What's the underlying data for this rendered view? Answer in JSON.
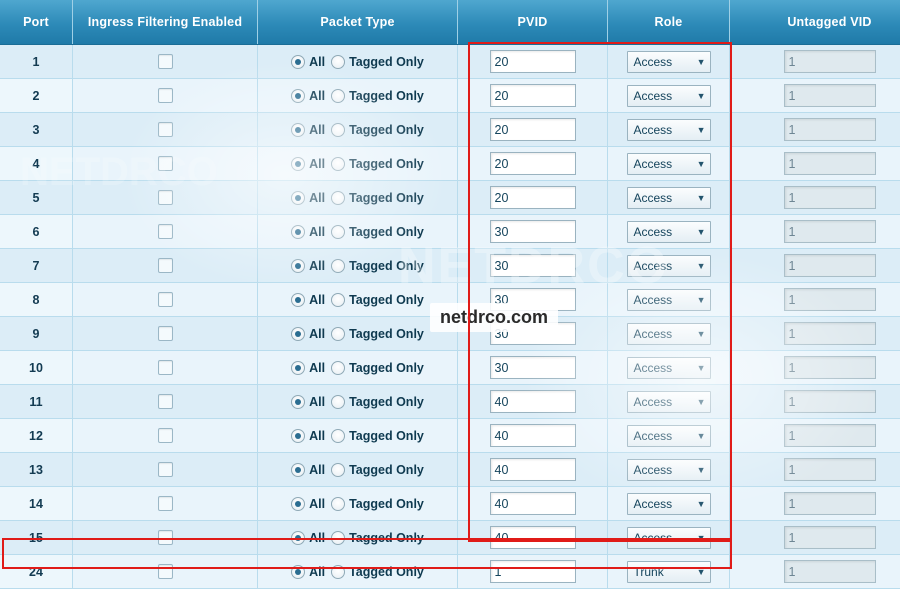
{
  "table": {
    "headers": [
      "Port",
      "Ingress Filtering Enabled",
      "Packet Type",
      "PVID",
      "Role",
      "Untagged VID"
    ],
    "packet_type_options": [
      "All",
      "Tagged Only"
    ],
    "rows": [
      {
        "port": "1",
        "ingress_checked": false,
        "packet_type": "All",
        "pvid": "20",
        "role": "Access",
        "untagged_vid": "1"
      },
      {
        "port": "2",
        "ingress_checked": false,
        "packet_type": "All",
        "pvid": "20",
        "role": "Access",
        "untagged_vid": "1"
      },
      {
        "port": "3",
        "ingress_checked": false,
        "packet_type": "All",
        "pvid": "20",
        "role": "Access",
        "untagged_vid": "1"
      },
      {
        "port": "4",
        "ingress_checked": false,
        "packet_type": "All",
        "pvid": "20",
        "role": "Access",
        "untagged_vid": "1"
      },
      {
        "port": "5",
        "ingress_checked": false,
        "packet_type": "All",
        "pvid": "20",
        "role": "Access",
        "untagged_vid": "1"
      },
      {
        "port": "6",
        "ingress_checked": false,
        "packet_type": "All",
        "pvid": "30",
        "role": "Access",
        "untagged_vid": "1"
      },
      {
        "port": "7",
        "ingress_checked": false,
        "packet_type": "All",
        "pvid": "30",
        "role": "Access",
        "untagged_vid": "1"
      },
      {
        "port": "8",
        "ingress_checked": false,
        "packet_type": "All",
        "pvid": "30",
        "role": "Access",
        "untagged_vid": "1"
      },
      {
        "port": "9",
        "ingress_checked": false,
        "packet_type": "All",
        "pvid": "30",
        "role": "Access",
        "untagged_vid": "1"
      },
      {
        "port": "10",
        "ingress_checked": false,
        "packet_type": "All",
        "pvid": "30",
        "role": "Access",
        "untagged_vid": "1"
      },
      {
        "port": "11",
        "ingress_checked": false,
        "packet_type": "All",
        "pvid": "40",
        "role": "Access",
        "untagged_vid": "1"
      },
      {
        "port": "12",
        "ingress_checked": false,
        "packet_type": "All",
        "pvid": "40",
        "role": "Access",
        "untagged_vid": "1"
      },
      {
        "port": "13",
        "ingress_checked": false,
        "packet_type": "All",
        "pvid": "40",
        "role": "Access",
        "untagged_vid": "1"
      },
      {
        "port": "14",
        "ingress_checked": false,
        "packet_type": "All",
        "pvid": "40",
        "role": "Access",
        "untagged_vid": "1"
      },
      {
        "port": "15",
        "ingress_checked": false,
        "packet_type": "All",
        "pvid": "40",
        "role": "Access",
        "untagged_vid": "1"
      },
      {
        "port": "24",
        "ingress_checked": false,
        "packet_type": "All",
        "pvid": "1",
        "role": "Trunk",
        "untagged_vid": "1"
      }
    ]
  },
  "watermarks": {
    "center": "netdrco.com",
    "big": "NETDRCO",
    "left": "NETDRCO"
  },
  "icons": {
    "caret": "▼"
  },
  "colors": {
    "header_start": "#4fa7cf",
    "header_end": "#1f7aa8",
    "row_bg": "#dcedf7",
    "row_alt_bg": "#e9f4fb",
    "highlight_border": "#e01b18",
    "text": "#133b52"
  }
}
